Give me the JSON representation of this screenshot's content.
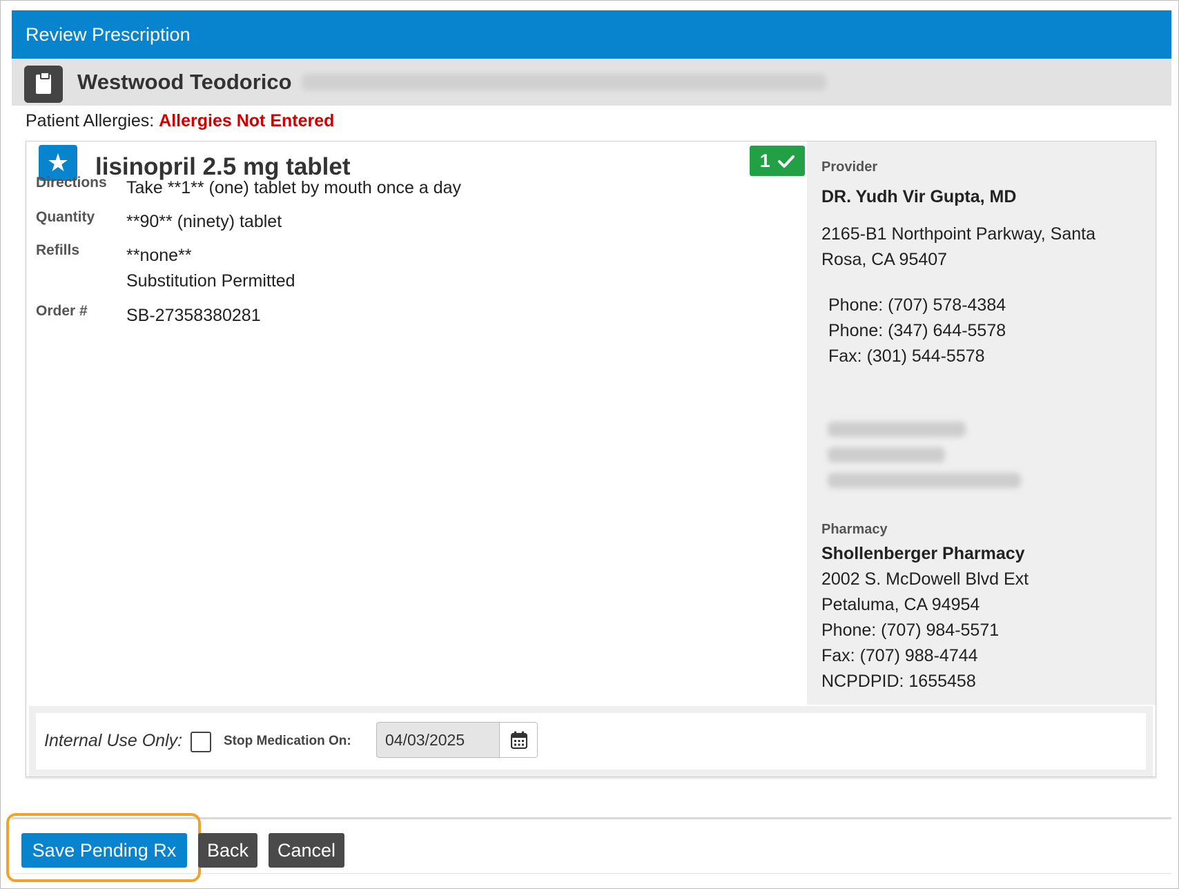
{
  "window": {
    "title": "Review Prescription"
  },
  "patient": {
    "name": "Westwood Teodorico",
    "allergies_label": "Patient Allergies:",
    "allergies_value": "Allergies Not Entered"
  },
  "prescription": {
    "drug_name": "lisinopril 2.5 mg tablet",
    "badge_count": "1",
    "fields": {
      "directions_label": "Directions",
      "directions_value": "Take **1** (one) tablet by mouth once a day",
      "quantity_label": "Quantity",
      "quantity_value": "**90** (ninety) tablet",
      "refills_label": "Refills",
      "refills_value": "**none**",
      "substitution_value": "Substitution Permitted",
      "order_label": "Order #",
      "order_value": "SB-27358380281"
    }
  },
  "provider": {
    "section_label": "Provider",
    "name": "DR. Yudh Vir Gupta, MD",
    "address_line1": "2165-B1 Northpoint Parkway, Santa",
    "address_line2": "Rosa, CA 95407",
    "phone1": "Phone: (707) 578-4384",
    "phone2": "Phone: (347) 644-5578",
    "fax": "Fax: (301) 544-5578"
  },
  "pharmacy": {
    "section_label": "Pharmacy",
    "name": "Shollenberger Pharmacy",
    "address_line1": "2002 S. McDowell Blvd Ext",
    "address_line2": "Petaluma, CA 94954",
    "phone": "Phone: (707) 984-5571",
    "fax": "Fax: (707) 988-4744",
    "ncpdpid": "NCPDPID: 1655458"
  },
  "internal": {
    "label": "Internal Use Only:",
    "stop_label": "Stop Medication On:",
    "stop_date": "04/03/2025"
  },
  "actions": {
    "save_label": "Save Pending Rx",
    "back_label": "Back",
    "cancel_label": "Cancel"
  },
  "colors": {
    "header_blue": "#0784cd",
    "alert_red": "#d10000",
    "check_green": "#22a046",
    "highlight_orange": "#f2a22b",
    "dark_button": "#4a4a4a"
  },
  "icons": {
    "patient": "clipboard-icon",
    "favorite": "star-icon",
    "check": "checkmark-icon",
    "calendar": "calendar-icon"
  }
}
